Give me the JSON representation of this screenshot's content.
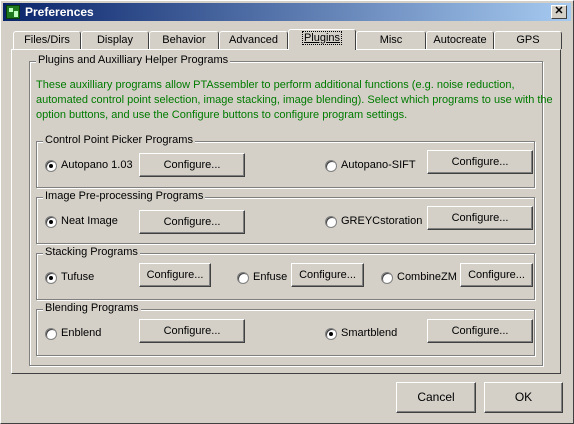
{
  "window": {
    "title": "Preferences",
    "close_label": "✕"
  },
  "tabs": [
    {
      "label": "Files/Dirs"
    },
    {
      "label": "Display"
    },
    {
      "label": "Behavior"
    },
    {
      "label": "Advanced"
    },
    {
      "label": "Plugins",
      "selected": true
    },
    {
      "label": "Misc"
    },
    {
      "label": "Autocreate"
    },
    {
      "label": "GPS"
    }
  ],
  "plugins": {
    "outer_group_title": "Plugins and Auxilliary Helper Programs",
    "info_lines": [
      "These auxilliary programs allow PTAssembler to perform additional functions (e.g. noise reduction,",
      "automated control point selection, image stacking, image blending).  Select which programs to use with the",
      "option buttons, and use the Configure buttons to configure program settings."
    ],
    "groups": {
      "cpp": {
        "title": "Control Point Picker Programs",
        "options": [
          {
            "label": "Autopano 1.03",
            "checked": true,
            "button": "Configure..."
          },
          {
            "label": "Autopano-SIFT",
            "checked": false,
            "button": "Configure..."
          }
        ]
      },
      "preproc": {
        "title": "Image Pre-processing Programs",
        "options": [
          {
            "label": "Neat Image",
            "checked": true,
            "button": "Configure..."
          },
          {
            "label": "GREYCstoration",
            "checked": false,
            "button": "Configure..."
          }
        ]
      },
      "stacking": {
        "title": "Stacking Programs",
        "options": [
          {
            "label": "Tufuse",
            "checked": true,
            "button": "Configure..."
          },
          {
            "label": "Enfuse",
            "checked": false,
            "button": "Configure..."
          },
          {
            "label": "CombineZM",
            "checked": false,
            "button": "Configure..."
          }
        ]
      },
      "blending": {
        "title": "Blending Programs",
        "options": [
          {
            "label": "Enblend",
            "checked": false,
            "button": "Configure..."
          },
          {
            "label": "Smartblend",
            "checked": true,
            "button": "Configure..."
          }
        ]
      }
    }
  },
  "footer": {
    "cancel_label": "Cancel",
    "ok_label": "OK"
  }
}
